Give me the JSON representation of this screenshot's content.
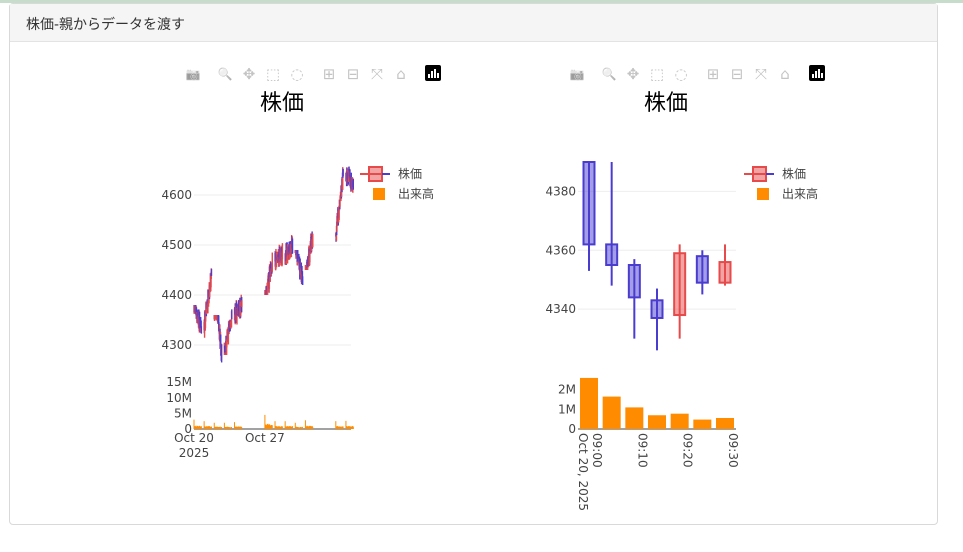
{
  "panel": {
    "title": "株価-親からデータを渡す"
  },
  "modebar": {
    "icons": [
      "camera-icon",
      "zoom-icon",
      "pan-icon",
      "box-select-icon",
      "lasso-select-icon",
      "zoom-in-icon",
      "zoom-out-icon",
      "autoscale-icon",
      "reset-axes-icon",
      "plotly-logo-icon"
    ]
  },
  "colors": {
    "increasing": "#e64a4a",
    "decreasing": "#4a3ccf",
    "volume": "#ff8c00",
    "grid": "#eeeeee",
    "axis_text": "#444444"
  },
  "chart_data": [
    {
      "type": "candlestick",
      "title": "株価",
      "legend": {
        "placement": "top-right",
        "entries": [
          "株価",
          "出来高"
        ]
      },
      "price_axis": {
        "ylim": [
          4250,
          4670
        ],
        "ticks": [
          4300,
          4400,
          4500,
          4600
        ]
      },
      "volume_axis": {
        "ylim": [
          0,
          16000000
        ],
        "ticks": [
          0,
          5000000,
          10000000,
          15000000
        ],
        "tick_labels": [
          "0",
          "5M",
          "10M",
          "15M"
        ]
      },
      "x_axis": {
        "range": [
          "2025-10-20",
          "2025-11-04"
        ],
        "tick_labels": [
          "Oct 20\n2025",
          "Oct 27"
        ],
        "tick_dates": [
          "2025-10-20",
          "2025-10-27"
        ]
      },
      "series": [
        {
          "name": "株価",
          "x": [
            "2025-10-20",
            "2025-10-21",
            "2025-10-22",
            "2025-10-23",
            "2025-10-24",
            "2025-10-27",
            "2025-10-28",
            "2025-10-29",
            "2025-10-30",
            "2025-10-31",
            "2025-11-03",
            "2025-11-04"
          ],
          "close": [
            4330,
            4445,
            4280,
            4360,
            4380,
            4470,
            4480,
            4500,
            4430,
            4520,
            4640,
            4620
          ],
          "high": [
            4380,
            4475,
            4360,
            4390,
            4420,
            4530,
            4530,
            4520,
            4490,
            4540,
            4660,
            4660
          ],
          "low": [
            4310,
            4310,
            4260,
            4280,
            4330,
            4400,
            4430,
            4400,
            4420,
            4450,
            4500,
            4590
          ]
        },
        {
          "name": "出来高",
          "x": [
            "2025-10-20",
            "2025-10-21",
            "2025-10-22",
            "2025-10-23",
            "2025-10-24",
            "2025-10-27",
            "2025-10-28",
            "2025-10-29",
            "2025-10-30",
            "2025-10-31",
            "2025-11-03",
            "2025-11-04"
          ],
          "values": [
            3000000,
            2500000,
            2000000,
            2000000,
            2200000,
            4500000,
            2500000,
            2500000,
            2000000,
            2800000,
            2500000,
            2600000
          ]
        }
      ]
    },
    {
      "type": "candlestick",
      "title": "株価",
      "legend": {
        "placement": "top-right",
        "entries": [
          "株価",
          "出来高"
        ]
      },
      "price_axis": {
        "ylim": [
          4320,
          4390
        ],
        "ticks": [
          4340,
          4360,
          4380
        ]
      },
      "volume_axis": {
        "ylim": [
          0,
          2800000
        ],
        "ticks": [
          0,
          1000000,
          2000000
        ],
        "tick_labels": [
          "0",
          "1M",
          "2M"
        ]
      },
      "x_axis": {
        "tick_labels": [
          "09:00\nOct 20, 2025",
          "09:10",
          "09:20",
          "09:30"
        ],
        "tick_minutes": [
          0,
          10,
          20,
          30
        ]
      },
      "series": [
        {
          "name": "株価",
          "minute": [
            0,
            5,
            10,
            15,
            20,
            25,
            30
          ],
          "open": [
            4390,
            4362,
            4355,
            4343,
            4338,
            4358,
            4349
          ],
          "high": [
            4390,
            4390,
            4357,
            4347,
            4362,
            4360,
            4362
          ],
          "low": [
            4353,
            4348,
            4330,
            4326,
            4330,
            4345,
            4348
          ],
          "close": [
            4362,
            4355,
            4344,
            4337,
            4359,
            4349,
            4356
          ]
        },
        {
          "name": "出来高",
          "minute": [
            0,
            5,
            10,
            15,
            20,
            25,
            30
          ],
          "values": [
            2600000,
            1650000,
            1100000,
            700000,
            780000,
            480000,
            560000
          ]
        }
      ]
    }
  ]
}
